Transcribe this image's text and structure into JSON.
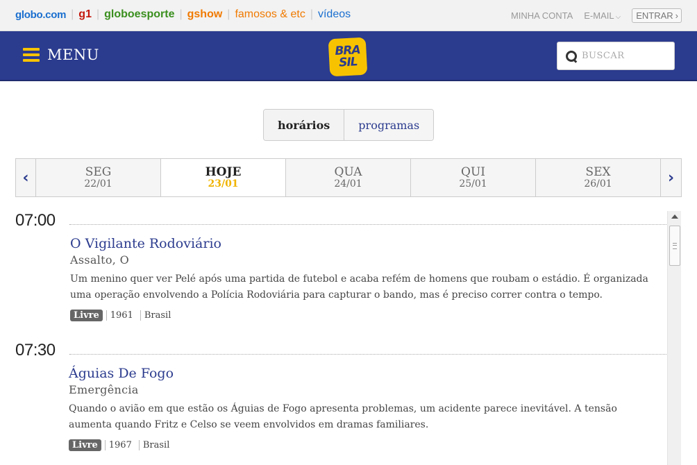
{
  "globobar": {
    "links": [
      {
        "label": "globo.com",
        "cls": "gl-globo",
        "name": "globocom-link"
      },
      {
        "label": "g1",
        "cls": "gl-g1",
        "name": "g1-link"
      },
      {
        "label": "globoesporte",
        "cls": "gl-ge",
        "name": "globoesporte-link"
      },
      {
        "label": "gshow",
        "cls": "gl-gshow",
        "name": "gshow-link"
      },
      {
        "label": "famosos & etc",
        "cls": "gl-famosos",
        "name": "famosos-link"
      },
      {
        "label": "vídeos",
        "cls": "gl-videos",
        "name": "videos-link"
      }
    ],
    "minha_conta": "MINHA CONTA",
    "email": "E-MAIL",
    "entrar": "ENTRAR"
  },
  "header": {
    "menu_label": "MENU",
    "logo_line1": "BRA",
    "logo_line2": "SIL",
    "search_placeholder": "BUSCAR"
  },
  "tabs": {
    "active": "horários",
    "inactive": "programas"
  },
  "days": [
    {
      "name": "SEG",
      "date": "22/01",
      "today": false
    },
    {
      "name": "HOJE",
      "date": "23/01",
      "today": true
    },
    {
      "name": "QUA",
      "date": "24/01",
      "today": false
    },
    {
      "name": "QUI",
      "date": "25/01",
      "today": false
    },
    {
      "name": "SEX",
      "date": "26/01",
      "today": false
    }
  ],
  "schedule": [
    {
      "time": "07:00",
      "title": "O Vigilante Rodoviário",
      "subtitle": "Assalto, O",
      "description": "Um menino quer ver Pelé após uma partida de futebol e acaba refém de homens que roubam o estádio. É organizada uma operação envolvendo a Polícia Rodoviária para capturar o bando, mas é preciso correr contra o tempo.",
      "rating": "Livre",
      "year": "1961",
      "country": "Brasil"
    },
    {
      "time": "07:30",
      "title": "Águias De Fogo",
      "subtitle": "Emergência",
      "description": "Quando o avião em que estão os Águias de Fogo apresenta problemas, um acidente parece inevitável. A tensão aumenta quando Fritz e Celso se veem envolvidos em dramas familiares.",
      "rating": "Livre",
      "year": "1967",
      "country": "Brasil"
    }
  ],
  "colors": {
    "brand_blue": "#2b3b8e",
    "brand_yellow": "#f7c300"
  }
}
